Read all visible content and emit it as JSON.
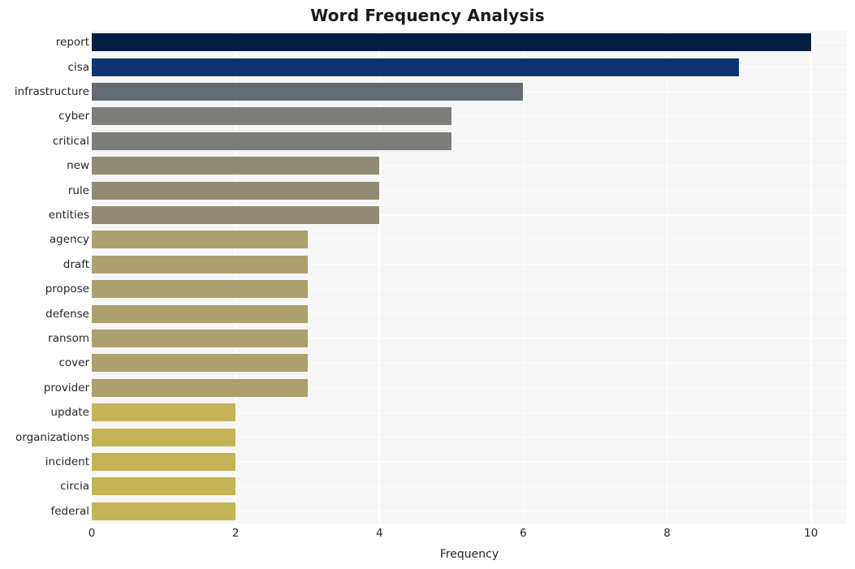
{
  "chart_data": {
    "type": "bar",
    "orientation": "horizontal",
    "title": "Word Frequency Analysis",
    "xlabel": "Frequency",
    "ylabel": "",
    "xlim": [
      0,
      10.5
    ],
    "xticks": [
      0,
      2,
      4,
      6,
      8,
      10
    ],
    "xtick_labels": [
      "0",
      "2",
      "4",
      "6",
      "8",
      "10"
    ],
    "grid": true,
    "legend": null,
    "categories": [
      "report",
      "cisa",
      "infrastructure",
      "cyber",
      "critical",
      "new",
      "rule",
      "entities",
      "agency",
      "draft",
      "propose",
      "defense",
      "ransom",
      "cover",
      "provider",
      "update",
      "organizations",
      "incident",
      "circia",
      "federal"
    ],
    "values": [
      10,
      9,
      6,
      5,
      5,
      4,
      4,
      4,
      3,
      3,
      3,
      3,
      3,
      3,
      3,
      2,
      2,
      2,
      2,
      2
    ],
    "bar_colors": [
      "#041e42",
      "#0d3372",
      "#646a72",
      "#7d7d7a",
      "#7d7d7a",
      "#918b73",
      "#918b73",
      "#918b73",
      "#aca06e",
      "#aca06e",
      "#aca06e",
      "#aca06e",
      "#aca06e",
      "#aca06e",
      "#aca06e",
      "#c5b358",
      "#c5b358",
      "#c5b358",
      "#c5b358",
      "#c5b358"
    ],
    "plot_background": "#f6f6f6",
    "grid_color": "#ffffff",
    "figure_background": "#ffffff",
    "text_color": "#262626"
  }
}
